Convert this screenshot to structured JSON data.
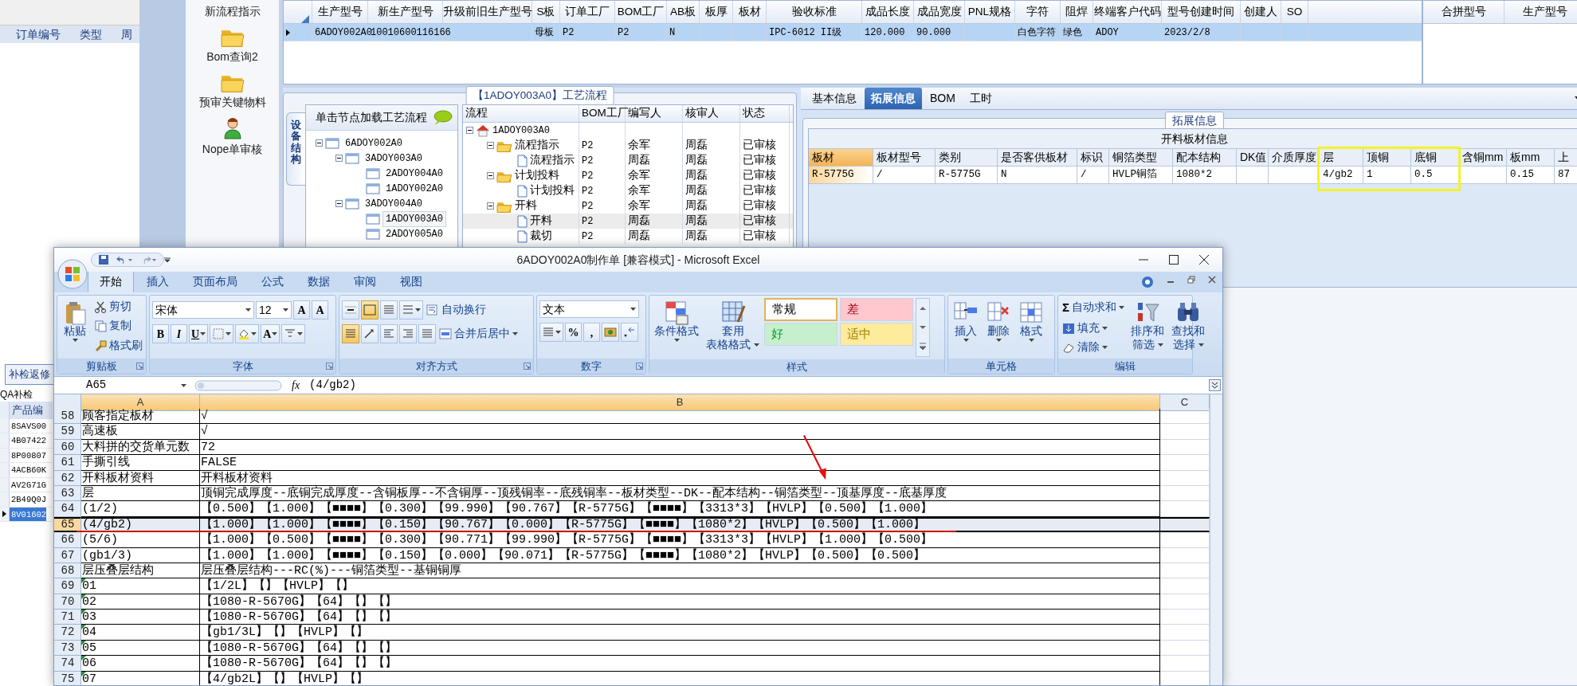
{
  "left_panel": {
    "columns": [
      "订单编号",
      "类型",
      "周"
    ],
    "button": "补检返修",
    "section_label": "QA补检",
    "list_header": "产品编",
    "products": [
      {
        "code": "8SAVS00",
        "selected": false
      },
      {
        "code": "4B07422",
        "selected": false
      },
      {
        "code": "8P00807",
        "selected": false
      },
      {
        "code": "4ACB60K",
        "selected": false
      },
      {
        "code": "AV2G71G",
        "selected": false
      },
      {
        "code": "2B49Q0J",
        "selected": false
      },
      {
        "code": "8V01602",
        "selected": true
      }
    ]
  },
  "launcher": [
    {
      "kind": "none",
      "label": "新流程指示"
    },
    {
      "kind": "folder",
      "label": "Bom查询2"
    },
    {
      "kind": "folder",
      "label": "预审关键物料"
    },
    {
      "kind": "person",
      "label": "Nope单审核"
    }
  ],
  "product_grid": {
    "columns": [
      "生产型号",
      "新生产型号",
      "升级前旧生产型号",
      "S板",
      "订单工厂",
      "BOM工厂",
      "AB板",
      "板厚",
      "板材",
      "验收标准",
      "成品长度",
      "成品宽度",
      "PNL规格",
      "字符",
      "阻焊",
      "终端客户代码",
      "型号创建时间",
      "创建人",
      "SO"
    ],
    "rows": [
      {
        "selected": true,
        "cells": [
          {
            "text": "6ADOY002A0"
          },
          {
            "text": "10010600116166"
          },
          {},
          {
            "text": "母板"
          },
          {
            "text": "P2"
          },
          {
            "text": "P2"
          },
          {
            "text": "N"
          },
          {},
          {},
          {
            "text": "IPC-6012 II级"
          },
          {
            "text": "120.000"
          },
          {
            "text": "90.000"
          },
          {},
          {
            "text": "白色字符"
          },
          {
            "text": "绿色"
          },
          {
            "text": "ADOY"
          },
          {
            "text": "2023/2/8"
          },
          {},
          {}
        ]
      }
    ]
  },
  "merge_table": {
    "columns": [
      "合拼型号",
      "生产型号"
    ]
  },
  "process": {
    "title": "【1ADOY003A0】工艺流程",
    "side_tab": "设备结构",
    "hint": "单击节点加载工艺流程",
    "tree": [
      {
        "label": "6ADOY002A0",
        "selected": false,
        "expanded": true,
        "children": [
          {
            "label": "3ADOY003A0",
            "selected": false,
            "expanded": true,
            "children": [
              {
                "label": "2ADOY004A0",
                "selected": false
              },
              {
                "label": "1ADOY002A0",
                "selected": false
              }
            ]
          },
          {
            "label": "3ADOY004A0",
            "selected": false,
            "expanded": true,
            "children": [
              {
                "label": "1ADOY003A0",
                "selected": true
              },
              {
                "label": "2ADOY005A0",
                "selected": false
              }
            ]
          }
        ]
      }
    ],
    "grid": {
      "columns": [
        "流程",
        "BOM工厂",
        "编写人",
        "核审人",
        "状态"
      ],
      "tree": [
        {
          "kind": "root",
          "label": "1ADOY003A0",
          "selected": false,
          "expanded": true,
          "children": [
            {
              "kind": "folder",
              "label": "流程指示",
              "bom": "P2",
              "writer": "余军",
              "reviewer": "周磊",
              "status": "已审核",
              "selected": false,
              "expanded": true,
              "children": [
                {
                  "kind": "doc",
                  "label": "流程指示",
                  "bom": "P2",
                  "writer": "周磊",
                  "reviewer": "周磊",
                  "status": "已审核",
                  "selected": false
                }
              ]
            },
            {
              "kind": "folder",
              "label": "计划投料",
              "bom": "P2",
              "writer": "余军",
              "reviewer": "周磊",
              "status": "已审核",
              "selected": false,
              "expanded": true,
              "children": [
                {
                  "kind": "doc",
                  "label": "计划投料",
                  "bom": "P2",
                  "writer": "余军",
                  "reviewer": "周磊",
                  "status": "已审核",
                  "selected": false
                }
              ]
            },
            {
              "kind": "folder",
              "label": "开料",
              "bom": "P2",
              "writer": "余军",
              "reviewer": "周磊",
              "status": "已审核",
              "selected": false,
              "expanded": true,
              "children": [
                {
                  "kind": "doc",
                  "label": "开料",
                  "bom": "P2",
                  "writer": "周磊",
                  "reviewer": "周磊",
                  "status": "已审核",
                  "selected": true
                },
                {
                  "kind": "doc",
                  "label": "裁切",
                  "bom": "P2",
                  "writer": "周磊",
                  "reviewer": "周磊",
                  "status": "已审核",
                  "selected": false
                }
              ]
            }
          ]
        }
      ]
    }
  },
  "details": {
    "tabs": [
      {
        "label": "基本信息",
        "selected": false
      },
      {
        "label": "拓展信息",
        "selected": true
      },
      {
        "label": "BOM",
        "selected": false
      },
      {
        "label": "工时",
        "selected": false
      }
    ],
    "group_title": "拓展信息",
    "table_title": "开料板材信息",
    "columns": [
      {
        "label": "板材",
        "selected": true
      },
      {
        "label": "板材型号",
        "selected": false
      },
      {
        "label": "类别",
        "selected": false
      },
      {
        "label": "是否客供板材",
        "selected": false
      },
      {
        "label": "标识",
        "selected": false
      },
      {
        "label": "铜箔类型",
        "selected": false
      },
      {
        "label": "配本结构",
        "selected": false
      },
      {
        "label": "DK值",
        "selected": false
      },
      {
        "label": "介质厚度",
        "selected": false
      },
      {
        "label": "层",
        "selected": false
      },
      {
        "label": "顶铜",
        "selected": false
      },
      {
        "label": "底铜",
        "selected": false
      },
      {
        "label": "含铜mm",
        "selected": false
      },
      {
        "label": "板mm",
        "selected": false
      },
      {
        "label": "上",
        "selected": false
      }
    ],
    "rows": [
      {
        "cells": [
          {
            "text": "R-5775G"
          },
          {
            "text": "/"
          },
          {
            "text": "R-5775G"
          },
          {
            "text": "N"
          },
          {
            "text": "/"
          },
          {
            "text": "HVLP铜箔"
          },
          {
            "text": "1080*2"
          },
          {},
          {},
          {
            "text": "4/gb2"
          },
          {
            "text": "1"
          },
          {
            "text": "0.5"
          },
          {},
          {
            "text": "0.15"
          },
          {
            "text": "87"
          }
        ]
      }
    ]
  },
  "excel": {
    "title": "6ADOY002A0制作单  [兼容模式] - Microsoft Excel",
    "tabs": [
      {
        "label": "开始",
        "selected": true
      },
      {
        "label": "插入",
        "selected": false
      },
      {
        "label": "页面布局",
        "selected": false
      },
      {
        "label": "公式",
        "selected": false
      },
      {
        "label": "数据",
        "selected": false
      },
      {
        "label": "审阅",
        "selected": false
      },
      {
        "label": "视图",
        "selected": false
      }
    ],
    "ribbon": [
      {
        "label": "剪贴板",
        "launcher": true,
        "columns": [
          [
            {
              "kind": "big",
              "lines": [
                "粘贴"
              ],
              "dropdown": true
            }
          ],
          [
            {
              "kind": "small",
              "label": "剪切"
            },
            {
              "kind": "small",
              "label": "复制"
            },
            {
              "kind": "small",
              "label": "格式刷"
            }
          ]
        ]
      },
      {
        "label": "字体",
        "launcher": true,
        "lines": [
          [
            {
              "kind": "combo",
              "value": "宋体",
              "wide": true
            },
            {
              "kind": "combo",
              "value": "12"
            },
            {
              "kind": "tool",
              "text": "A"
            },
            {
              "kind": "tool",
              "text": "A"
            }
          ],
          [
            {
              "kind": "tool",
              "text": "B"
            },
            {
              "kind": "tool",
              "text": "I"
            },
            {
              "kind": "tool",
              "text": "U",
              "dropdown": true
            },
            {
              "kind": "tool",
              "dropdown": true
            },
            {
              "kind": "tool",
              "dropdown": true
            },
            {
              "kind": "tool",
              "text": "A",
              "dropdown": true
            },
            {
              "kind": "tool",
              "dropdown": true
            }
          ]
        ]
      },
      {
        "label": "对齐方式",
        "launcher": true,
        "lines": [
          [
            {
              "kind": "tool"
            },
            {
              "kind": "tool",
              "on": true
            },
            {
              "kind": "tool"
            },
            {
              "kind": "tool",
              "dropdown": true
            },
            {
              "kind": "small",
              "label": "自动换行"
            }
          ],
          [
            {
              "kind": "tool",
              "on": true
            },
            {
              "kind": "tool"
            },
            {
              "kind": "tool"
            },
            {
              "kind": "tool"
            },
            {
              "kind": "tool"
            },
            {
              "kind": "small",
              "label": "合并后居中",
              "dropdown": true
            }
          ]
        ]
      },
      {
        "label": "数字",
        "launcher": true,
        "lines": [
          [
            {
              "kind": "combo",
              "value": "文本",
              "wide": true
            }
          ],
          [
            {
              "kind": "tool",
              "dropdown": true
            },
            {
              "kind": "tool",
              "text": "%"
            },
            {
              "kind": "tool",
              "text": ","
            },
            {
              "kind": "tool"
            },
            {
              "kind": "tool"
            }
          ]
        ]
      },
      {
        "label": "样式",
        "launcher": false,
        "columns": [
          [
            {
              "kind": "big",
              "lines": [
                "条件格式"
              ],
              "dropdown": true
            }
          ],
          [
            {
              "kind": "big",
              "lines": [
                "套用",
                "表格格式"
              ],
              "dropdown": true
            }
          ],
          [
            {
              "kind": "style",
              "label": "常规",
              "color": "#ffffff",
              "selected": true
            },
            {
              "kind": "style",
              "label": "好",
              "color": "#c6efce",
              "selected": false
            }
          ],
          [
            {
              "kind": "style",
              "label": "差",
              "color": "#ffc7ce",
              "selected": false
            },
            {
              "kind": "style",
              "label": "适中",
              "color": "#ffeb9c",
              "selected": false
            }
          ],
          [
            {
              "kind": "scroll"
            }
          ]
        ]
      },
      {
        "label": "单元格",
        "launcher": false,
        "columns": [
          [
            {
              "kind": "big",
              "lines": [
                "插入"
              ],
              "dropdown": true
            }
          ],
          [
            {
              "kind": "big",
              "lines": [
                "删除"
              ],
              "dropdown": true
            }
          ],
          [
            {
              "kind": "big",
              "lines": [
                "格式"
              ],
              "dropdown": true
            }
          ]
        ]
      },
      {
        "label": "编辑",
        "launcher": false,
        "columns": [
          [
            {
              "kind": "small",
              "glyph": "Σ",
              "label": "自动求和",
              "dropdown": true
            },
            {
              "kind": "small",
              "label": "填充",
              "dropdown": true
            },
            {
              "kind": "small",
              "label": "清除",
              "dropdown": true
            }
          ],
          [
            {
              "kind": "big",
              "lines": [
                "排序和",
                "筛选"
              ],
              "dropdown": true
            }
          ],
          [
            {
              "kind": "big",
              "lines": [
                "查找和",
                "选择"
              ],
              "dropdown": true
            }
          ]
        ]
      }
    ],
    "name_box": "A65",
    "fx": "fx",
    "formula": "(4/gb2)",
    "columns": [
      {
        "label": "A",
        "selected": true
      },
      {
        "label": "B",
        "selected": true
      },
      {
        "label": "C",
        "selected": false
      }
    ],
    "rows": [
      {
        "number": "58",
        "a": "顾客指定板材",
        "b": "√",
        "selected": false,
        "flagged": false
      },
      {
        "number": "59",
        "a": "高速板",
        "b": "√",
        "selected": false,
        "flagged": false
      },
      {
        "number": "60",
        "a": "大料拼的交货单元数",
        "b": "72",
        "selected": false,
        "flagged": false
      },
      {
        "number": "61",
        "a": "手撕引线",
        "b": "FALSE",
        "selected": false,
        "flagged": false
      },
      {
        "number": "62",
        "a": "开料板材资料",
        "b": "开料板材资料",
        "selected": false,
        "flagged": false
      },
      {
        "number": "63",
        "a": "层",
        "b": "顶铜完成厚度--底铜完成厚度--含铜板厚--不含铜厚--顶残铜率--底残铜率--板材类型--DK--配本结构--铜箔类型--顶基厚度--底基厚度",
        "selected": false,
        "flagged": false
      },
      {
        "number": "64",
        "a": "(1/2)",
        "b": "【0.500】【1.000】【■■■■】【0.300】【99.990】【90.767】【R-5775G】【■■■■】【3313*3】【HVLP】【0.500】【1.000】",
        "selected": false,
        "flagged": false
      },
      {
        "number": "65",
        "a": "(4/gb2)",
        "b": "【1.000】【1.000】【■■■■】【0.150】【90.767】【0.000】【R-5775G】【■■■■】【1080*2】【HVLP】【0.500】【1.000】",
        "selected": true,
        "flagged": false
      },
      {
        "number": "66",
        "a": "(5/6)",
        "b": "【1.000】【0.500】【■■■■】【0.300】【90.771】【99.990】【R-5775G】【■■■■】【3313*3】【HVLP】【1.000】【0.500】",
        "selected": false,
        "flagged": false
      },
      {
        "number": "67",
        "a": "(gb1/3)",
        "b": "【1.000】【1.000】【■■■■】【0.150】【0.000】【90.071】【R-5775G】【■■■■】【1080*2】【HVLP】【0.500】【0.500】",
        "selected": false,
        "flagged": false
      },
      {
        "number": "68",
        "a": "层压叠层结构",
        "b": "层压叠层结构---RC(%)---铜箔类型--基铜铜厚",
        "selected": false,
        "flagged": false
      },
      {
        "number": "69",
        "a": "01",
        "b": "【1/2L】【】【HVLP】【】",
        "selected": false,
        "flagged": true
      },
      {
        "number": "70",
        "a": "02",
        "b": "【1080-R-5670G】【64】【】【】",
        "selected": false,
        "flagged": true
      },
      {
        "number": "71",
        "a": "03",
        "b": "【1080-R-5670G】【64】【】【】",
        "selected": false,
        "flagged": true
      },
      {
        "number": "72",
        "a": "04",
        "b": "【gb1/3L】【】【HVLP】【】",
        "selected": false,
        "flagged": true
      },
      {
        "number": "73",
        "a": "05",
        "b": "【1080-R-5670G】【64】【】【】",
        "selected": false,
        "flagged": true
      },
      {
        "number": "74",
        "a": "06",
        "b": "【1080-R-5670G】【64】【】【】",
        "selected": false,
        "flagged": true
      },
      {
        "number": "75",
        "a": "07",
        "b": "【4/gb2L】【】【HVLP】【】",
        "selected": false,
        "flagged": true
      }
    ]
  }
}
